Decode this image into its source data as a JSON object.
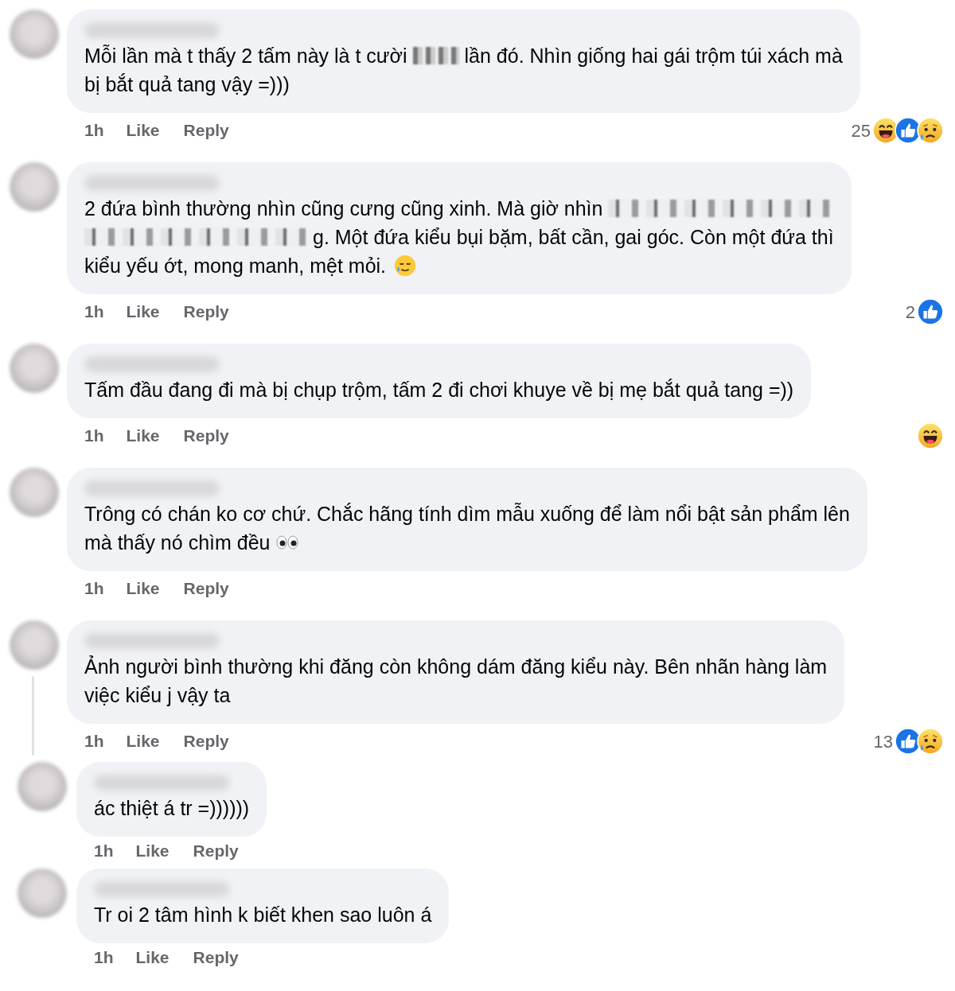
{
  "comments": [
    {
      "lines": [
        [
          {
            "kind": "text",
            "text": "Mỗi lần mà t thấy 2 tấm này là t cười"
          },
          {
            "kind": "blur"
          },
          {
            "kind": "text",
            "text": "lần đó. Nhìn giống hai gái trộm túi xách mà"
          }
        ],
        [
          {
            "kind": "text",
            "text": "bị bắt quả tang vậy =)))"
          }
        ]
      ],
      "time": "1h",
      "like": "Like",
      "reply": "Reply",
      "reaction_count": "25",
      "reactions": [
        {
          "kind": "haha"
        },
        {
          "kind": "like"
        },
        {
          "kind": "sad"
        }
      ]
    },
    {
      "lines": [
        [
          {
            "kind": "text",
            "text": "2 đứa bình thường nhìn cũng cưng cũng xinh. Mà giờ nhìn"
          },
          {
            "kind": "pixels"
          }
        ],
        [
          {
            "kind": "pixels"
          },
          {
            "kind": "text",
            "text": "g. Một đứa kiểu bụi bặm, bất cần, gai góc. Còn một đứa thì"
          }
        ],
        [
          {
            "kind": "text",
            "text": "kiểu yếu ớt, mong manh, mệt mỏi."
          },
          {
            "kind": "teary"
          }
        ]
      ],
      "time": "1h",
      "like": "Like",
      "reply": "Reply",
      "reaction_count": "2",
      "reactions": [
        {
          "kind": "like"
        }
      ]
    },
    {
      "lines": [
        [
          {
            "kind": "text",
            "text": "Tấm đầu đang đi mà bị chụp trộm, tấm 2 đi chơi khuye về bị mẹ bắt quả tang =))"
          }
        ]
      ],
      "time": "1h",
      "like": "Like",
      "reply": "Reply",
      "reactions": [
        {
          "kind": "haha"
        }
      ]
    },
    {
      "lines": [
        [
          {
            "kind": "text",
            "text": "Trông có chán ko cơ chứ. Chắc hãng tính dìm mẫu xuống để làm nổi bật sản phẩm lên"
          }
        ],
        [
          {
            "kind": "text",
            "text": "mà thấy nó chìm đều"
          },
          {
            "kind": "eyes"
          }
        ]
      ],
      "time": "1h",
      "like": "Like",
      "reply": "Reply"
    },
    {
      "lines": [
        [
          {
            "kind": "text",
            "text": "Ảnh người bình thường khi đăng còn không dám đăng kiểu này. Bên nhãn hàng làm"
          }
        ],
        [
          {
            "kind": "text",
            "text": "việc kiểu j vậy ta"
          }
        ]
      ],
      "time": "1h",
      "like": "Like",
      "reply": "Reply",
      "reaction_count": "13",
      "reactions": [
        {
          "kind": "like"
        },
        {
          "kind": "sad"
        }
      ],
      "replies": [
        {
          "lines": [
            [
              {
                "kind": "text",
                "text": "ác thiệt á tr =))))))"
              }
            ]
          ],
          "time": "1h",
          "like": "Like",
          "reply": "Reply"
        },
        {
          "lines": [
            [
              {
                "kind": "text",
                "text": "Tr oi 2 tâm hình k biết khen sao luôn á"
              }
            ]
          ],
          "time": "1h",
          "like": "Like",
          "reply": "Reply"
        }
      ]
    }
  ]
}
